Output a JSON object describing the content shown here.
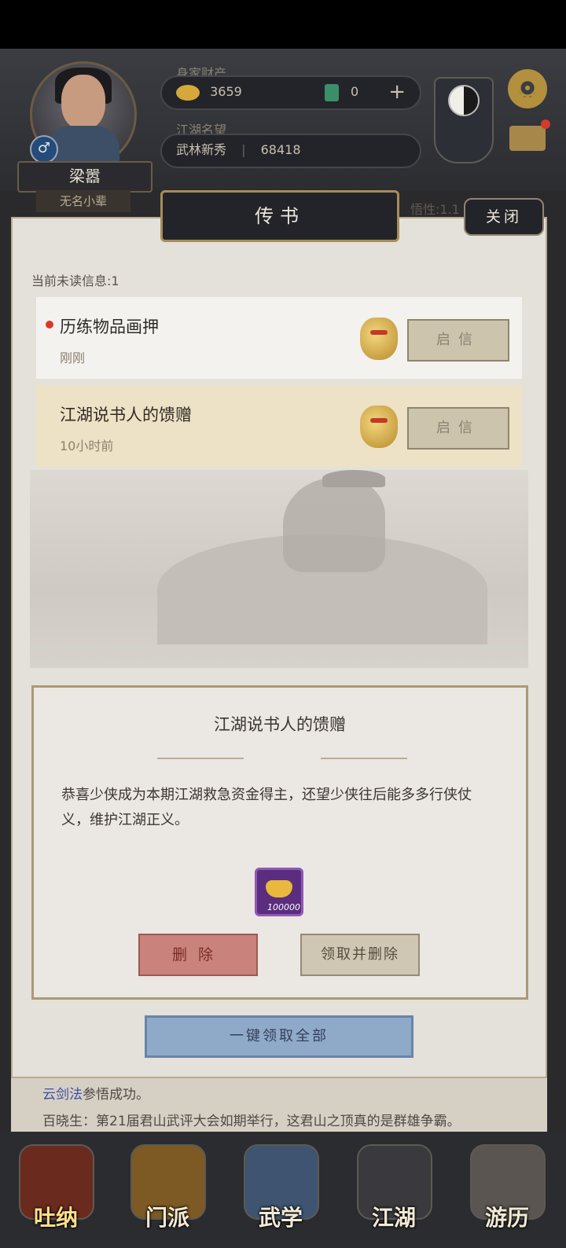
{
  "header": {
    "wealth_label": "身家财产",
    "gold_amount": "3659",
    "jade_amount": "0",
    "add_symbol": "+",
    "fame_label": "江湖名望",
    "fame_rank": "武林新秀",
    "fame_value": "68418",
    "player_name": "梁嚣",
    "player_subtitle": "无名小辈",
    "gender_symbol": "♂",
    "stat_hint": "悟性:1.1"
  },
  "dialog": {
    "title": "传书",
    "close_label": "关闭",
    "unread_text": "当前未读信息:1",
    "messages": [
      {
        "title": "历练物品画押",
        "time": "刚刚",
        "button": "启信",
        "unread": true
      },
      {
        "title": "江湖说书人的馈赠",
        "time": "10小时前",
        "button": "启信",
        "unread": false
      }
    ],
    "detail": {
      "title": "江湖说书人的馈赠",
      "body": "恭喜少侠成为本期江湖救急资金得主，还望少侠往后能多多行侠仗义，维护江湖正义。",
      "reward_amount": "100000",
      "delete_label": "删除",
      "claim_delete_label": "领取并删除"
    },
    "claim_all_label": "一键领取全部"
  },
  "log": {
    "line1_highlight": "云剑法",
    "line1_rest": "参悟成功。",
    "line2": "百晓生：第21届君山武评大会如期举行，这君山之顶真的是群雄争霸。"
  },
  "nav": [
    {
      "label": "吐纳",
      "icon": "gourd-icon",
      "active": true
    },
    {
      "label": "门派",
      "icon": "banner-icon",
      "active": false
    },
    {
      "label": "武学",
      "icon": "scroll-book-icon",
      "active": false
    },
    {
      "label": "江湖",
      "icon": "straw-hat-icon",
      "active": false
    },
    {
      "label": "游历",
      "icon": "horse-icon",
      "active": false
    }
  ],
  "colors": {
    "panel_bg": "#e4e0da",
    "highlight_row": "#ede2c5",
    "delete_button": "#c9837c",
    "claim_all_button": "#8fa9c9",
    "unread_dot": "#d83a2a"
  }
}
